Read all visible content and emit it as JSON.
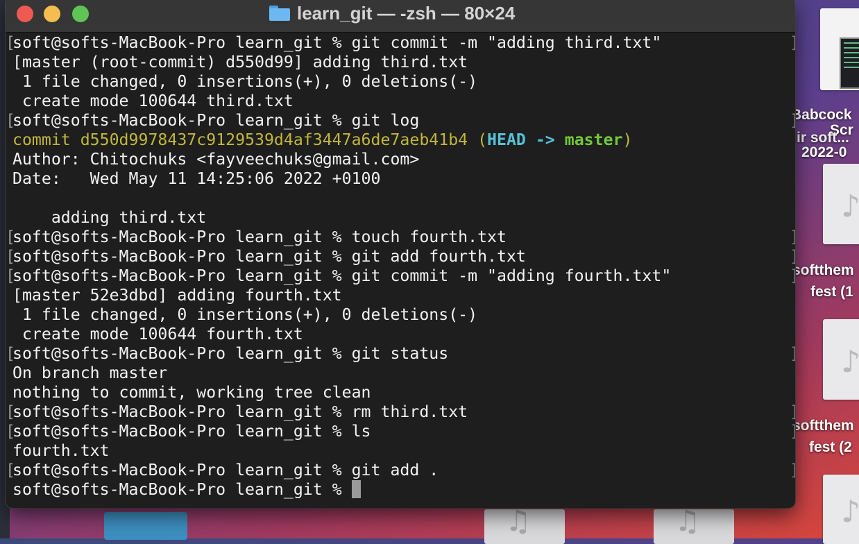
{
  "window": {
    "title": "learn_git — -zsh — 80×24"
  },
  "desktop": {
    "labels": [
      "Babcock",
      "Scr",
      "ir soft...",
      "2022-0",
      "softthem",
      "fest (1",
      "softthem",
      "fest (2"
    ]
  },
  "terminal": {
    "prompt": "soft@softs-MacBook-Pro learn_git % ",
    "lines": [
      "soft@softs-MacBook-Pro learn_git % git commit -m \"adding third.txt\"",
      "[master (root-commit) d550d99] adding third.txt",
      " 1 file changed, 0 insertions(+), 0 deletions(-)",
      " create mode 100644 third.txt",
      "soft@softs-MacBook-Pro learn_git % git log",
      "commit d550d9978437c9129539d4af3447a6de7aeb41b4",
      "Author: Chitochuks <fayveechuks@gmail.com>",
      "Date:   Wed May 11 14:25:06 2022 +0100",
      "",
      "    adding third.txt",
      "soft@softs-MacBook-Pro learn_git % touch fourth.txt",
      "soft@softs-MacBook-Pro learn_git % git add fourth.txt",
      "soft@softs-MacBook-Pro learn_git % git commit -m \"adding fourth.txt\"",
      "[master 52e3dbd] adding fourth.txt",
      " 1 file changed, 0 insertions(+), 0 deletions(-)",
      " create mode 100644 fourth.txt",
      "soft@softs-MacBook-Pro learn_git % git status",
      "On branch master",
      "nothing to commit, working tree clean",
      "soft@softs-MacBook-Pro learn_git % rm third.txt",
      "soft@softs-MacBook-Pro learn_git % ls",
      "fourth.txt",
      "soft@softs-MacBook-Pro learn_git % git add ."
    ],
    "ref_decoration": {
      "open": " (",
      "head": "HEAD -> ",
      "branch": "master",
      "close": ")"
    },
    "colors": {
      "background": "#1e1e1e",
      "text": "#f2f2f2",
      "commit_hash": "#c1b73a",
      "head": "#56c1d8",
      "branch": "#72c83b"
    }
  }
}
